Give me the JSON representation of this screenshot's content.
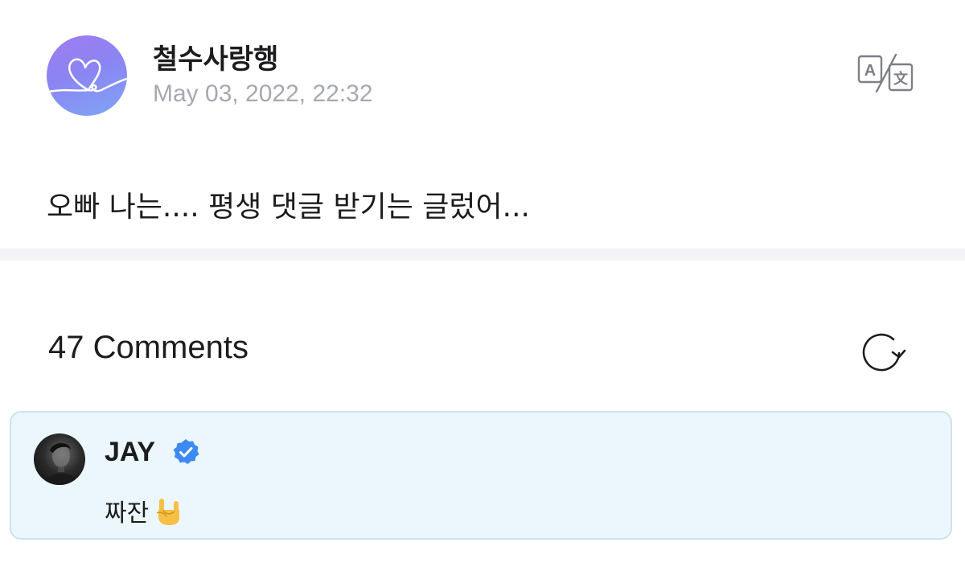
{
  "post": {
    "author": "철수사랑행",
    "date": "May 03, 2022, 22:32",
    "body": "오빠 나는.... 평생 댓글 받기는 글렀어...",
    "avatar_icon": "heart-doodle-avatar",
    "translate_icon": "translate-icon"
  },
  "comments": {
    "count_label": "47 Comments",
    "refresh_icon": "refresh-icon",
    "highlighted": {
      "author": "JAY",
      "verified": true,
      "text": "짜잔",
      "emoji": "🤘",
      "avatar_icon": "profile-photo"
    }
  },
  "colors": {
    "avatar_gradient_start": "#a07cf2",
    "avatar_gradient_end": "#7fa6f6",
    "date_text": "#a6a9b1",
    "divider": "#f3f3f8",
    "comment_bg": "#ecf7fd",
    "comment_border": "#cbe3ee",
    "verified_badge": "#3d8bf2"
  }
}
